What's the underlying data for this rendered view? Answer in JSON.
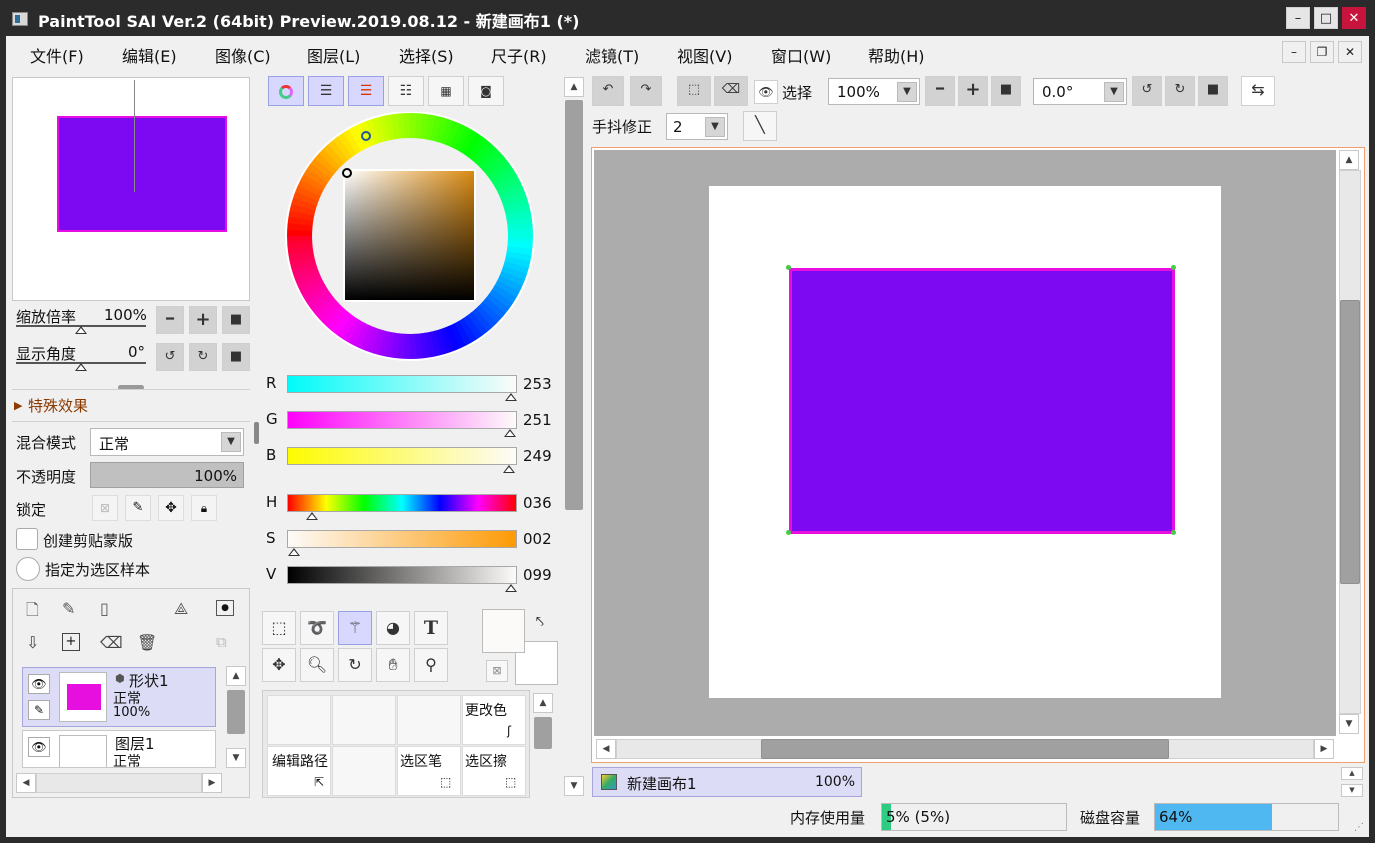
{
  "window": {
    "title": "PaintTool SAI Ver.2 (64bit) Preview.2019.08.12 - 新建画布1 (*)"
  },
  "menu": [
    "文件(F)",
    "编辑(E)",
    "图像(C)",
    "图层(L)",
    "选择(S)",
    "尺子(R)",
    "滤镜(T)",
    "视图(V)",
    "窗口(W)",
    "帮助(H)"
  ],
  "navigator": {
    "zoom_label": "缩放倍率",
    "zoom_value": "100%",
    "angle_label": "显示角度",
    "angle_value": "0°"
  },
  "layer_props": {
    "effects_label": "特殊效果",
    "blend_label": "混合模式",
    "blend_value": "正常",
    "opacity_label": "不透明度",
    "opacity_value": "100%",
    "lock_label": "锁定",
    "clip_label": "创建剪贴蒙版",
    "selsrc_label": "指定为选区样本"
  },
  "layers": [
    {
      "name": "形状1",
      "mode": "正常",
      "opacity": "100%",
      "thumb_color": "#e60fe0",
      "selected": true
    },
    {
      "name": "图层1",
      "mode": "正常",
      "opacity": "",
      "thumb_color": "#ffffff",
      "selected": false
    }
  ],
  "color": {
    "R": {
      "label": "R",
      "value": "253"
    },
    "G": {
      "label": "G",
      "value": "251"
    },
    "B": {
      "label": "B",
      "value": "249"
    },
    "H": {
      "label": "H",
      "value": "036"
    },
    "S": {
      "label": "S",
      "value": "002"
    },
    "V": {
      "label": "V",
      "value": "099"
    },
    "fg": "#fbfaf8",
    "bg": "#ffffff"
  },
  "brushes": {
    "change_color": "更改色",
    "edit_path": "编辑路径",
    "sel_pen": "选区笔",
    "sel_eraser": "选区擦"
  },
  "toolbar": {
    "select_label": "选择",
    "zoom": "100%",
    "angle": "0.0°",
    "stabilizer_label": "手抖修正",
    "stabilizer_value": "2"
  },
  "canvas": {
    "paper_color": "#ffffff",
    "shape_fill": "#7d08f2",
    "shape_stroke": "#e60fe0",
    "bg_color": "#acacac"
  },
  "doc_tab": {
    "name": "新建画布1",
    "zoom": "100%"
  },
  "status": {
    "mem_label": "内存使用量",
    "mem_value": "5% (5%)",
    "mem_fraction": 0.05,
    "disk_label": "磁盘容量",
    "disk_value": "64%",
    "disk_fraction": 0.64
  }
}
